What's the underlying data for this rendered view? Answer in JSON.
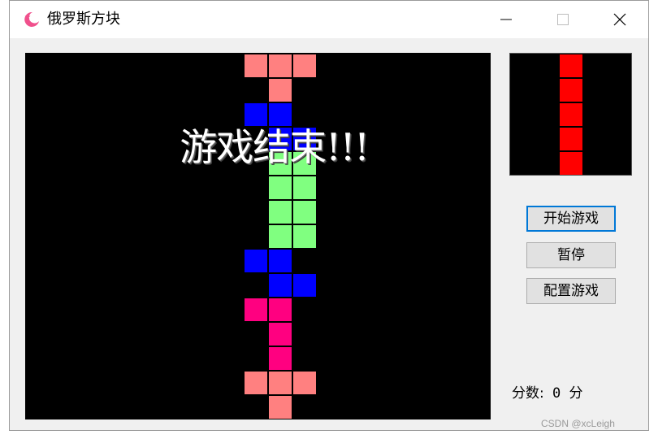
{
  "window": {
    "title": "俄罗斯方块",
    "icon": "moon-star-icon"
  },
  "board": {
    "cols": 19,
    "rows": 15,
    "game_over_text": "游戏结束!!!",
    "colors": {
      "salmon": "#ff8080",
      "blue": "#0000ff",
      "green": "#80ff80",
      "magenta": "#ff0080"
    },
    "cells": [
      {
        "r": 0,
        "c": 8,
        "k": "salmon"
      },
      {
        "r": 0,
        "c": 9,
        "k": "salmon"
      },
      {
        "r": 0,
        "c": 10,
        "k": "salmon"
      },
      {
        "r": 1,
        "c": 9,
        "k": "salmon"
      },
      {
        "r": 2,
        "c": 8,
        "k": "blue"
      },
      {
        "r": 2,
        "c": 9,
        "k": "blue"
      },
      {
        "r": 3,
        "c": 9,
        "k": "blue"
      },
      {
        "r": 3,
        "c": 10,
        "k": "blue"
      },
      {
        "r": 4,
        "c": 9,
        "k": "green"
      },
      {
        "r": 4,
        "c": 10,
        "k": "green"
      },
      {
        "r": 5,
        "c": 9,
        "k": "green"
      },
      {
        "r": 5,
        "c": 10,
        "k": "green"
      },
      {
        "r": 6,
        "c": 9,
        "k": "green"
      },
      {
        "r": 6,
        "c": 10,
        "k": "green"
      },
      {
        "r": 7,
        "c": 9,
        "k": "green"
      },
      {
        "r": 7,
        "c": 10,
        "k": "green"
      },
      {
        "r": 8,
        "c": 8,
        "k": "blue"
      },
      {
        "r": 8,
        "c": 9,
        "k": "blue"
      },
      {
        "r": 9,
        "c": 9,
        "k": "blue"
      },
      {
        "r": 9,
        "c": 10,
        "k": "blue"
      },
      {
        "r": 10,
        "c": 8,
        "k": "magenta"
      },
      {
        "r": 10,
        "c": 9,
        "k": "magenta"
      },
      {
        "r": 11,
        "c": 9,
        "k": "magenta"
      },
      {
        "r": 12,
        "c": 9,
        "k": "magenta"
      },
      {
        "r": 13,
        "c": 8,
        "k": "salmon"
      },
      {
        "r": 13,
        "c": 9,
        "k": "salmon"
      },
      {
        "r": 13,
        "c": 10,
        "k": "salmon"
      },
      {
        "r": 14,
        "c": 9,
        "k": "salmon"
      }
    ]
  },
  "next_piece": {
    "color": "#ff0000",
    "cells": [
      {
        "r": 0,
        "c": 2
      },
      {
        "r": 1,
        "c": 2
      },
      {
        "r": 2,
        "c": 2
      },
      {
        "r": 3,
        "c": 2
      },
      {
        "r": 4,
        "c": 2
      }
    ]
  },
  "buttons": {
    "start": "开始游戏",
    "pause": "暂停",
    "config": "配置游戏"
  },
  "score": {
    "label": "分数:",
    "value": "0",
    "unit": "分"
  },
  "watermark": "CSDN @xcLeigh"
}
